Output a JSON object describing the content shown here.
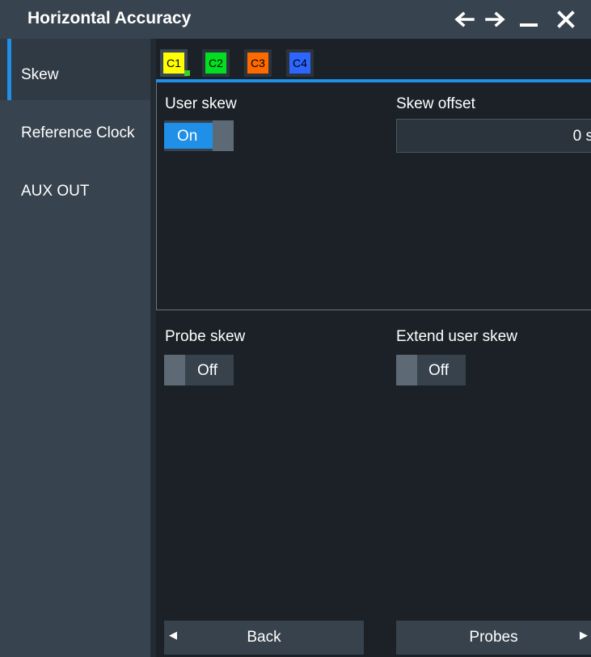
{
  "window": {
    "title": "Horizontal Accuracy",
    "controls": {
      "back": "back-arrow-icon",
      "forward": "forward-arrow-icon",
      "minimize": "minimize-icon",
      "close": "close-icon"
    }
  },
  "sidebar": {
    "items": [
      {
        "label": "Skew",
        "active": true
      },
      {
        "label": "Reference Clock",
        "active": false
      },
      {
        "label": "AUX OUT",
        "active": false
      }
    ]
  },
  "tabs": [
    {
      "label": "C1",
      "color": "#ffff00",
      "active": true
    },
    {
      "label": "C2",
      "color": "#00e020",
      "active": false
    },
    {
      "label": "C3",
      "color": "#ff6a00",
      "active": false
    },
    {
      "label": "C4",
      "color": "#2c66ff",
      "active": false
    }
  ],
  "skew": {
    "user_skew_label": "User skew",
    "user_skew_value": "On",
    "skew_offset_label": "Skew offset",
    "skew_offset_value": "0 s",
    "probe_skew_label": "Probe skew",
    "probe_skew_value": "Off",
    "extend_user_skew_label": "Extend user skew",
    "extend_user_skew_value": "Off"
  },
  "footer": {
    "back_label": "Back",
    "probes_label": "Probes"
  },
  "colors": {
    "accent": "#1f8fe8",
    "panel": "#37434e",
    "background": "#1b2127"
  }
}
